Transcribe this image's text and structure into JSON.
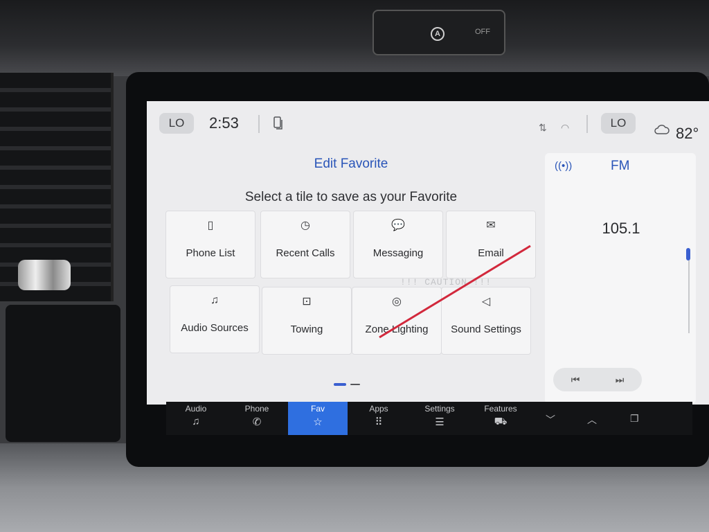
{
  "hardware": {
    "hazard_symbol": "A",
    "hazard_off": "OFF"
  },
  "status_bar": {
    "left_climate": "LO",
    "time": "2:53",
    "right_climate": "LO",
    "temperature": "82°"
  },
  "header": {
    "title": "Edit Favorite",
    "subtitle": "Select a tile to save as your Favorite"
  },
  "tiles": [
    {
      "label": "Phone List",
      "icon": "phone-list-icon",
      "glyph": "▯"
    },
    {
      "label": "Recent Calls",
      "icon": "clock-icon",
      "glyph": "◷"
    },
    {
      "label": "Messaging",
      "icon": "chat-bubble-icon",
      "glyph": "💬"
    },
    {
      "label": "Email",
      "icon": "envelope-icon",
      "glyph": "✉"
    },
    {
      "label": "Audio Sources",
      "icon": "audio-sources-icon",
      "glyph": "♫"
    },
    {
      "label": "Towing",
      "icon": "trailer-icon",
      "glyph": "⊡"
    },
    {
      "label": "Zone Lighting",
      "icon": "light-icon",
      "glyph": "◎"
    },
    {
      "label": "Sound Settings",
      "icon": "speaker-icon",
      "glyph": "◁"
    }
  ],
  "overlay": {
    "caution_text": "!!! CAUTION !!!",
    "stroke_color": "#d2283c"
  },
  "radio": {
    "band": "FM",
    "frequency": "105.1",
    "prev": "⏮",
    "next": "⏭"
  },
  "nav": [
    {
      "label": "Audio",
      "glyph": "♫",
      "active": false
    },
    {
      "label": "Phone",
      "glyph": "✆",
      "active": false
    },
    {
      "label": "Fav",
      "glyph": "☆",
      "active": true
    },
    {
      "label": "Apps",
      "glyph": "⠿",
      "active": false
    },
    {
      "label": "Settings",
      "glyph": "☰",
      "active": false
    },
    {
      "label": "Features",
      "glyph": "⛟",
      "active": false
    }
  ],
  "colors": {
    "accent": "#2a55b8",
    "nav_active": "#2f6fe0"
  }
}
